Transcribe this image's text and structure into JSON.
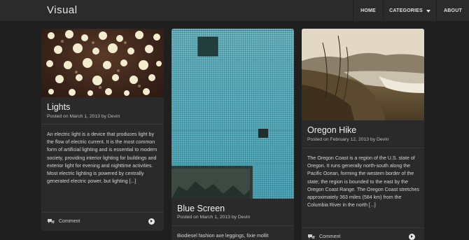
{
  "header": {
    "brand": "Visual",
    "nav": {
      "home": "HOME",
      "categories": "CATEGORIES",
      "about": "ABOUT"
    }
  },
  "posts": [
    {
      "title": "Lights",
      "meta": "Posted on March 1, 2013 by Devin",
      "excerpt": "An electric light is a device that produces light by the flow of electric current. It is the most common form of artificial lighting and is essential to modern society, providing interior lighting for buildings and exterior light for evening and nighttime activities. Most electric lighting is powered by centrally generated electric power, but lighting [...]",
      "comment_label": "Comment"
    },
    {
      "title": "Blue Screen",
      "meta": "Posted on March 1, 2013 by Devin",
      "excerpt": "Biodiesel fashion axe leggings, fixie mollit"
    },
    {
      "title": "Oregon Hike",
      "meta": "Posted on February 12, 2013 by Devin",
      "excerpt": "The Oregon Coast is a region of the U.S. state of Oregon. It runs generally north-south along the Pacific Ocean, forming the western border of the state; the region is bounded to the east by the Oregon Coast Range. The Oregon Coast stretches approximately 363 miles (584 km) from the Columbia River in the north [...]",
      "comment_label": "Comment"
    }
  ]
}
